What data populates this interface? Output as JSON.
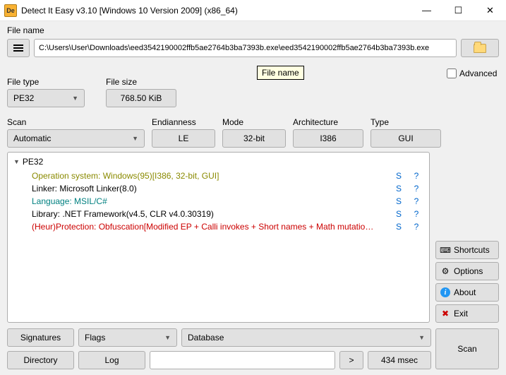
{
  "window": {
    "title": "Detect It Easy v3.10 [Windows 10 Version 2009] (x86_64)"
  },
  "labels": {
    "file_name": "File name",
    "file_type": "File type",
    "file_size": "File size",
    "scan": "Scan",
    "endianness": "Endianness",
    "mode": "Mode",
    "architecture": "Architecture",
    "type": "Type",
    "advanced": "Advanced"
  },
  "values": {
    "file_path": "C:\\Users\\User\\Downloads\\eed3542190002ffb5ae2764b3ba7393b.exe\\eed3542190002ffb5ae2764b3ba7393b.exe",
    "file_type": "PE32",
    "file_size": "768.50 KiB",
    "scan_mode": "Automatic",
    "endianness": "LE",
    "mode": "32-bit",
    "architecture": "I386",
    "type": "GUI"
  },
  "tooltip": "File name",
  "tree": {
    "root": "PE32",
    "lines": [
      {
        "text": "Operation system: Windows(95)[I386, 32-bit, GUI]",
        "cls": "c-olive",
        "s": "S",
        "q": "?"
      },
      {
        "text": "Linker: Microsoft Linker(8.0)",
        "cls": "",
        "s": "S",
        "q": "?"
      },
      {
        "text": "Language: MSIL/C#",
        "cls": "c-teal",
        "s": "S",
        "q": "?"
      },
      {
        "text": "Library: .NET Framework(v4.5, CLR v4.0.30319)",
        "cls": "",
        "s": "S",
        "q": "?"
      },
      {
        "text": "(Heur)Protection: Obfuscation[Modified EP + Calli invokes + Short names + Math mutatio…",
        "cls": "c-red",
        "s": "S",
        "q": "?"
      }
    ]
  },
  "right": {
    "shortcuts": "Shortcuts",
    "options": "Options",
    "about": "About",
    "exit": "Exit"
  },
  "bottom": {
    "signatures": "Signatures",
    "flags": "Flags",
    "database": "Database",
    "directory": "Directory",
    "log": "Log",
    "arrow": ">",
    "time": "434 msec",
    "scan": "Scan"
  }
}
